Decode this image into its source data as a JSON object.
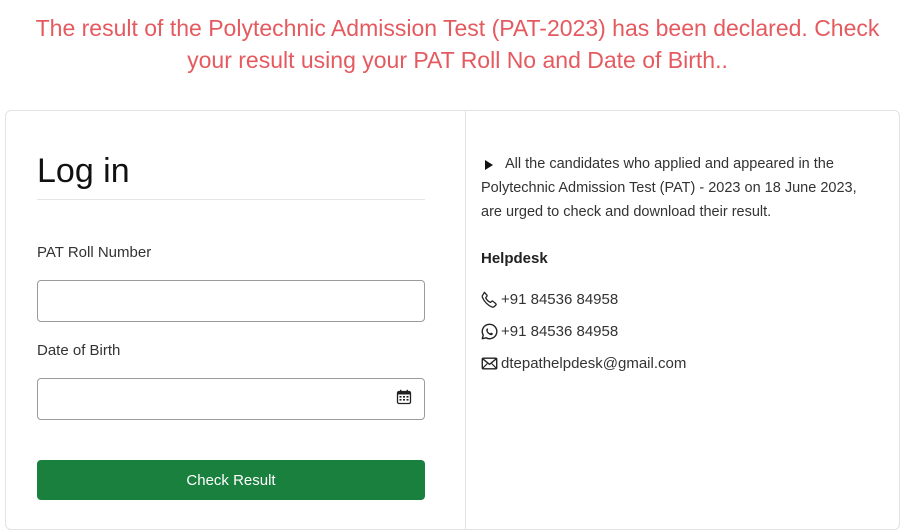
{
  "notice": {
    "text": "The result of the Polytechnic Admission Test (PAT-2023) has been declared. Check your result using your PAT Roll No and Date of Birth.."
  },
  "login": {
    "title": "Log in",
    "roll_label": "PAT Roll Number",
    "roll_value": "",
    "dob_label": "Date of Birth",
    "dob_value": "",
    "button_label": "Check Result"
  },
  "info": {
    "text": "All the candidates who applied and appeared in the Polytechnic Admission Test (PAT) - 2023 on 18 June 2023, are urged to check and download their result.",
    "helpdesk_title": "Helpdesk",
    "phone": "+91 84536 84958",
    "whatsapp": "+91 84536 84958",
    "email": "dtepathelpdesk@gmail.com"
  },
  "colors": {
    "notice": "#e45a5f",
    "button": "#19803d"
  }
}
